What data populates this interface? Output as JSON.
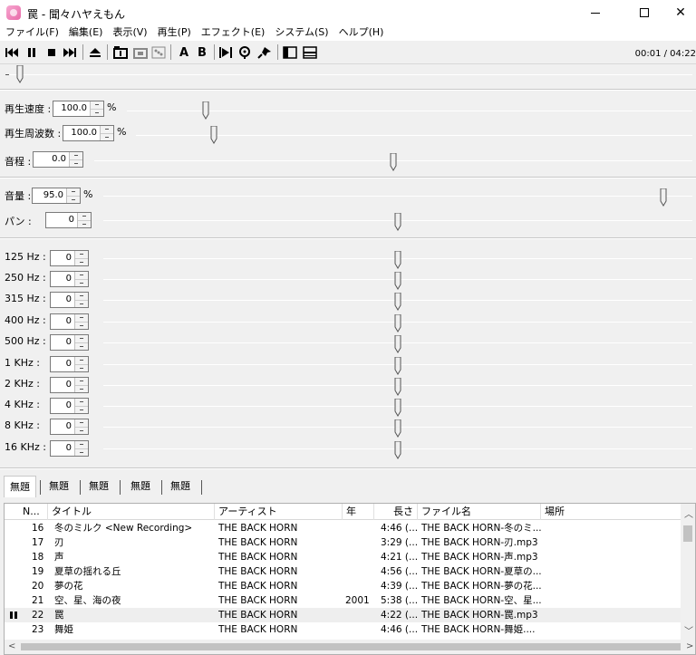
{
  "window": {
    "title": "罠 - 聞々ハヤえもん",
    "minimize_glyph": "—",
    "close_glyph": "✕"
  },
  "menu": [
    "ファイル(F)",
    "編集(E)",
    "表示(V)",
    "再生(P)",
    "エフェクト(E)",
    "システム(S)",
    "ヘルプ(H)"
  ],
  "toolbar": {
    "icons": [
      "skip-back-icon",
      "pause-icon",
      "stop-icon",
      "skip-forward-icon",
      "eject-icon",
      "loop-one-icon",
      "loop-all-icon",
      "random-icon",
      "marker-a-icon",
      "marker-b-icon",
      "ab-loop-icon",
      "marker-icon",
      "pin-icon",
      "panel-toggle-icon",
      "panel-split-icon"
    ],
    "a_label": "A",
    "b_label": "B",
    "time": "00:01 / 04:22",
    "position_fraction": 0.002
  },
  "speed": {
    "label": "再生速度 :",
    "value": "100.0",
    "unit": "%",
    "fraction": 0.14
  },
  "frequency": {
    "label": "再生周波数 :",
    "value": "100.0",
    "unit": "%",
    "fraction": 0.14
  },
  "pitch": {
    "label": "音程 :",
    "value": "0.0",
    "fraction": 0.5
  },
  "volume": {
    "label": "音量 :",
    "value": "95.0",
    "unit": "%",
    "fraction": 0.95
  },
  "pan": {
    "label": "パン :",
    "value": "0",
    "fraction": 0.5
  },
  "eq": [
    {
      "label": "125 Hz :",
      "value": "0",
      "fraction": 0.5
    },
    {
      "label": "250 Hz :",
      "value": "0",
      "fraction": 0.5
    },
    {
      "label": "315 Hz :",
      "value": "0",
      "fraction": 0.5
    },
    {
      "label": "400 Hz :",
      "value": "0",
      "fraction": 0.5
    },
    {
      "label": "500 Hz :",
      "value": "0",
      "fraction": 0.5
    },
    {
      "label": "1 KHz :",
      "value": "0",
      "fraction": 0.5
    },
    {
      "label": "2 KHz :",
      "value": "0",
      "fraction": 0.5
    },
    {
      "label": "4 KHz :",
      "value": "0",
      "fraction": 0.5
    },
    {
      "label": "8 KHz :",
      "value": "0",
      "fraction": 0.5
    },
    {
      "label": "16 KHz :",
      "value": "0",
      "fraction": 0.5
    }
  ],
  "tabs": [
    "無題",
    "無題",
    "無題",
    "無題",
    "無題"
  ],
  "playlist": {
    "columns": [
      "N...",
      "タイトル",
      "アーティスト",
      "年",
      "長さ",
      "ファイル名",
      "場所"
    ],
    "rows": [
      {
        "no": "16",
        "title": "冬のミルク <New Recording>",
        "artist": "THE BACK HORN",
        "year": "",
        "length": "4:46 (...",
        "file": "THE BACK HORN-冬のミ...",
        "playing": false
      },
      {
        "no": "17",
        "title": "刃",
        "artist": "THE BACK HORN",
        "year": "",
        "length": "3:29 (...",
        "file": "THE BACK HORN-刃.mp3",
        "playing": false
      },
      {
        "no": "18",
        "title": "声",
        "artist": "THE BACK HORN",
        "year": "",
        "length": "4:21 (...",
        "file": "THE BACK HORN-声.mp3",
        "playing": false
      },
      {
        "no": "19",
        "title": "夏草の揺れる丘",
        "artist": "THE BACK HORN",
        "year": "",
        "length": "4:56 (...",
        "file": "THE BACK HORN-夏草の...",
        "playing": false
      },
      {
        "no": "20",
        "title": "夢の花",
        "artist": "THE BACK HORN",
        "year": "",
        "length": "4:39 (...",
        "file": "THE BACK HORN-夢の花...",
        "playing": false
      },
      {
        "no": "21",
        "title": "空、星、海の夜",
        "artist": "THE BACK HORN",
        "year": "2001",
        "length": "5:38 (...",
        "file": "THE BACK HORN-空、星...",
        "playing": false
      },
      {
        "no": "22",
        "title": "罠",
        "artist": "THE BACK HORN",
        "year": "",
        "length": "4:22 (...",
        "file": "THE BACK HORN-罠.mp3",
        "playing": true
      },
      {
        "no": "23",
        "title": "舞姫",
        "artist": "THE BACK HORN",
        "year": "",
        "length": "4:46 (...",
        "file": "THE BACK HORN-舞姫....",
        "playing": false
      }
    ]
  },
  "colors": {
    "track": "#8a8a8a",
    "selected_row": "#eeeeee",
    "app_icon": "#e86aa8"
  }
}
